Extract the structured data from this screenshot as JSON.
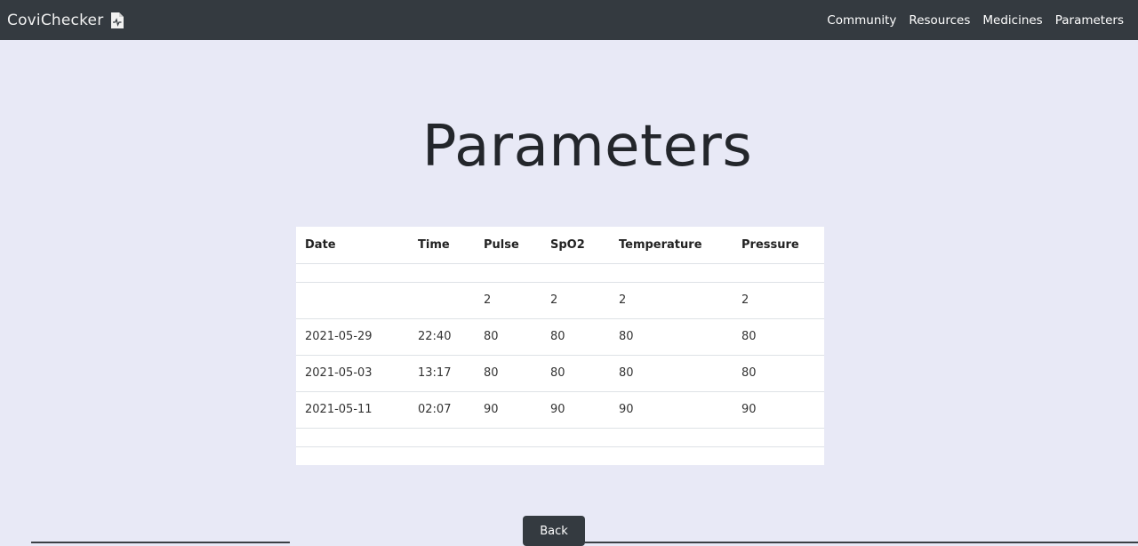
{
  "navbar": {
    "brand": "CoviChecker",
    "brand_icon": "medical-document-icon",
    "links": [
      "Community",
      "Resources",
      "Medicines",
      "Parameters"
    ],
    "background": "#343a40"
  },
  "page": {
    "title": "Parameters",
    "background": "#e8e9f6"
  },
  "table": {
    "headers": [
      "Date",
      "Time",
      "Pulse",
      "SpO2",
      "Temperature",
      "Pressure"
    ],
    "rows": [
      [
        "",
        "",
        "",
        "",
        "",
        ""
      ],
      [
        "",
        "",
        "2",
        "2",
        "2",
        "2"
      ],
      [
        "2021-05-29",
        "22:40",
        "80",
        "80",
        "80",
        "80"
      ],
      [
        "2021-05-03",
        "13:17",
        "80",
        "80",
        "80",
        "80"
      ],
      [
        "2021-05-11",
        "02:07",
        "90",
        "90",
        "90",
        "90"
      ],
      [
        "",
        "",
        "",
        "",
        "",
        ""
      ],
      [
        "",
        "",
        "",
        "",
        "",
        ""
      ]
    ]
  },
  "actions": {
    "back_label": "Back"
  }
}
